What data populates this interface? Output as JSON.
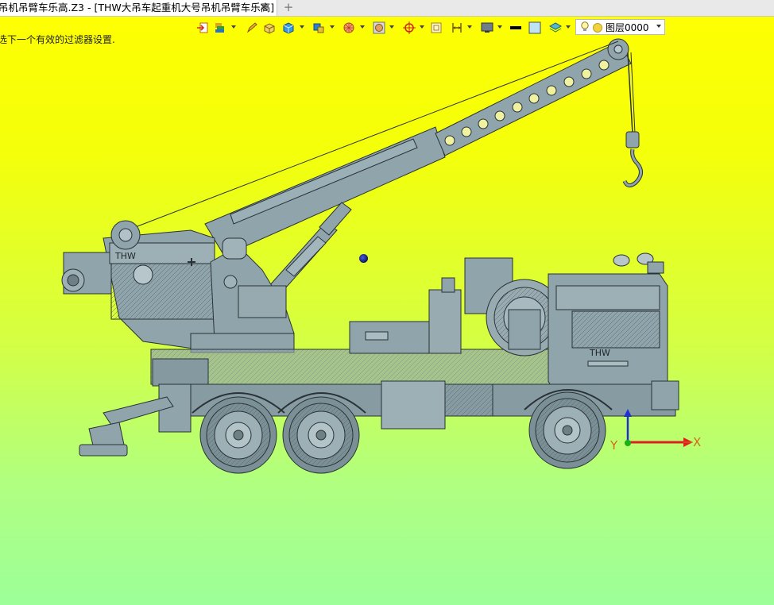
{
  "window": {
    "tab_title": "吊机吊臂车乐高.Z3 - [THW大吊车起重机大号吊机吊臂车乐高]",
    "tab_close_glyph": "✕",
    "new_tab_glyph": "+"
  },
  "prompt": {
    "text": "选下一个有效的过滤器设置."
  },
  "toolbar": {
    "buttons": [
      {
        "name": "exit-icon"
      },
      {
        "name": "layer-stack-icon"
      },
      {
        "name": "pencil-icon"
      },
      {
        "name": "feature-box-icon"
      },
      {
        "name": "solid-cube-icon"
      },
      {
        "name": "component-icon"
      },
      {
        "name": "sphere-wire-icon"
      },
      {
        "name": "render-mode-icon"
      },
      {
        "name": "snap-target-icon"
      },
      {
        "name": "frame-icon"
      },
      {
        "name": "dimension-icon"
      },
      {
        "name": "display-icon"
      },
      {
        "name": "line-color-icon"
      },
      {
        "name": "fill-color-icon"
      },
      {
        "name": "layer-icon"
      }
    ],
    "layer_select": {
      "value": "图层0000"
    }
  },
  "viewport": {
    "background_top": "#ffff00",
    "background_bottom": "#9cff99",
    "model_color": "#8fa4ab",
    "axis": {
      "x_label": "X",
      "y_label": "Y",
      "x_color": "#e02020",
      "y_color": "#19b019",
      "z_color": "#2030d0"
    }
  }
}
